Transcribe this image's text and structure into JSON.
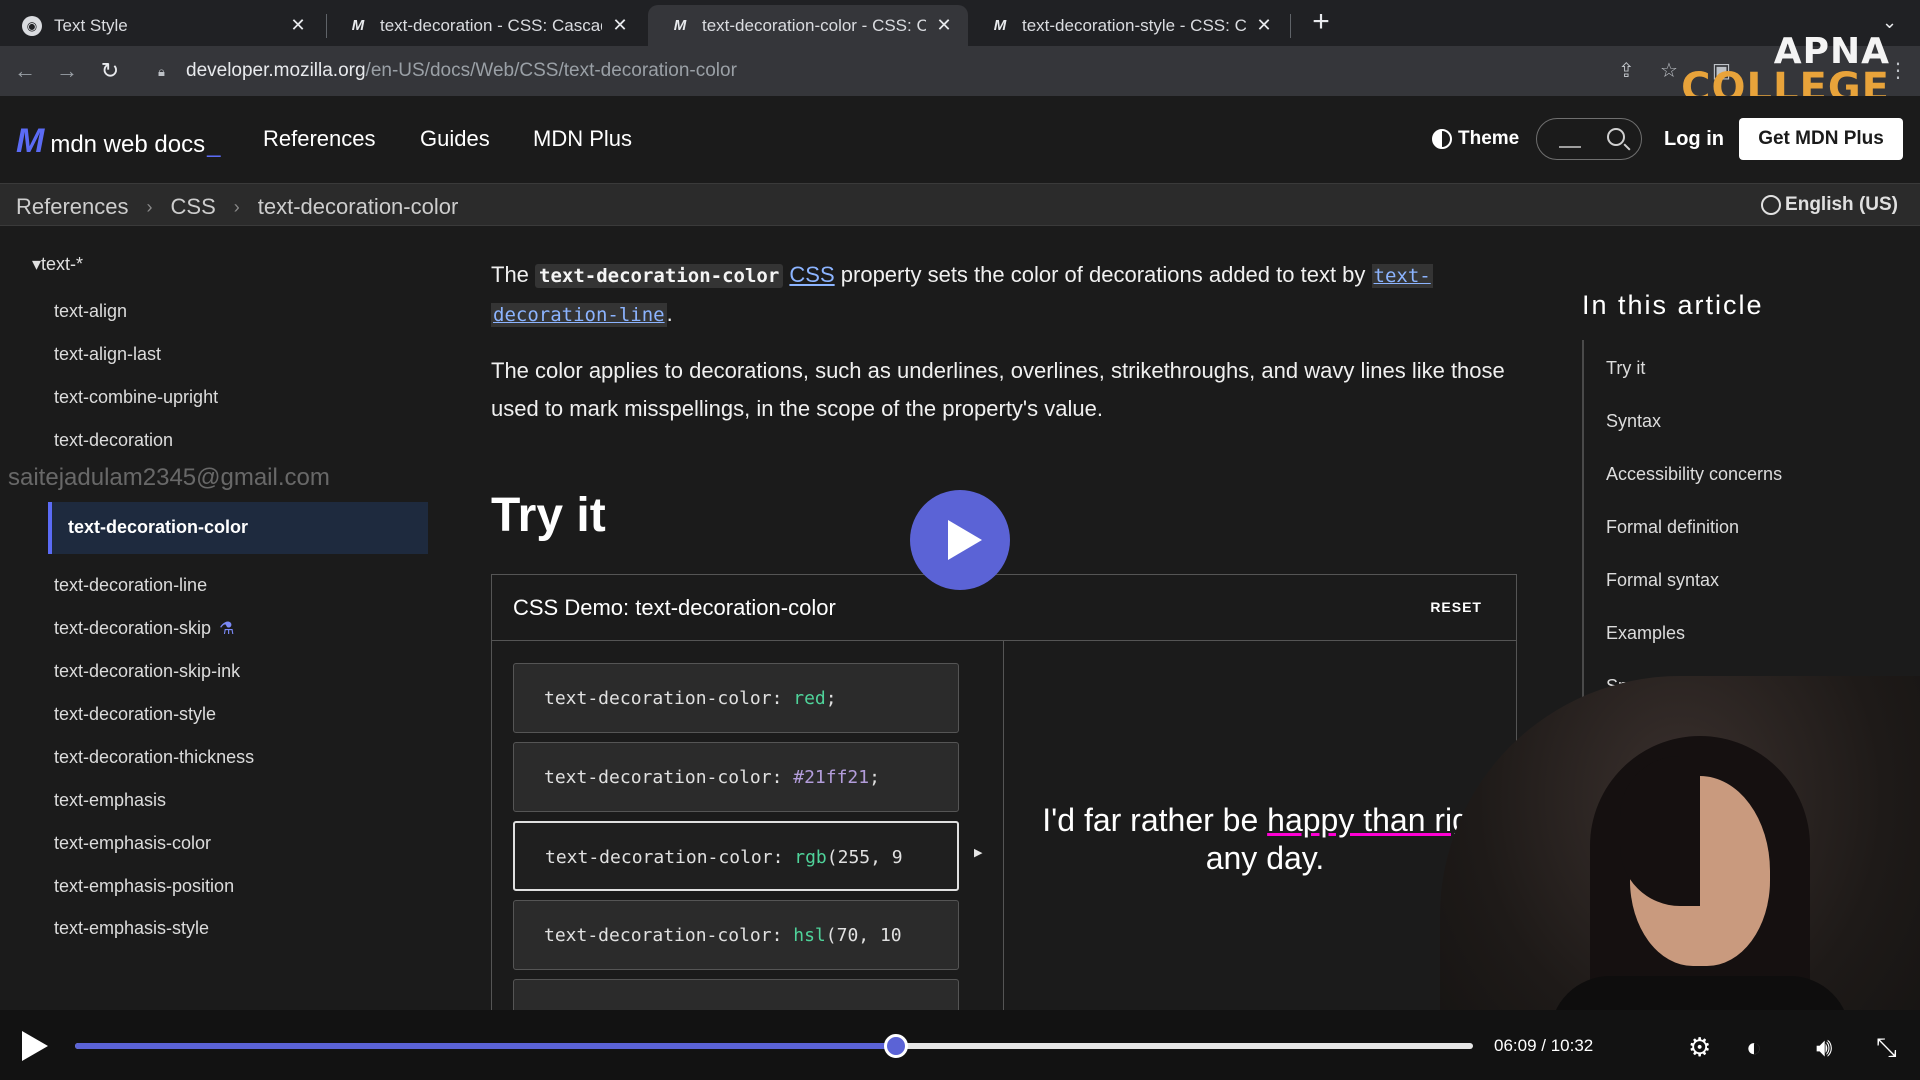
{
  "browser": {
    "tabs": [
      {
        "title": "Text Style",
        "icon": "globe-icon"
      },
      {
        "title": "text-decoration - CSS: Cascad",
        "icon": "mdn-icon"
      },
      {
        "title": "text-decoration-color - CSS: C",
        "icon": "mdn-icon",
        "active": true
      },
      {
        "title": "text-decoration-style - CSS: C",
        "icon": "mdn-icon"
      }
    ],
    "url_host": "developer.mozilla.org",
    "url_path": "/en-US/docs/Web/CSS/text-decoration-color"
  },
  "overlay_logo": {
    "line1": "APNA",
    "line2": "COLLEGE"
  },
  "mdn": {
    "logo_text": "mdn web docs",
    "nav": [
      "References",
      "Guides",
      "MDN Plus"
    ],
    "theme": "Theme",
    "login": "Log in",
    "get_plus": "Get MDN Plus",
    "breadcrumb": [
      "References",
      "CSS",
      "text-decoration-color"
    ],
    "language": "English (US)"
  },
  "sidebar": {
    "group": "▾text-*",
    "items": [
      "text-align",
      "text-align-last",
      "text-combine-upright",
      "text-decoration"
    ],
    "active": "text-decoration-color",
    "items_after": [
      "text-decoration-line",
      "text-decoration-skip",
      "text-decoration-skip-ink",
      "text-decoration-style",
      "text-decoration-thickness",
      "text-emphasis",
      "text-emphasis-color",
      "text-emphasis-position",
      "text-emphasis-style"
    ],
    "watermark": "saitejadulam2345@gmail.com"
  },
  "article": {
    "p1_the": "The",
    "p1_code": "text-decoration-color",
    "p1_link": "CSS",
    "p1_rest": "property sets the color of decorations added to text by",
    "p1_link2a": "text-",
    "p1_link2b": "decoration-line",
    "p1_end": ".",
    "p2": "The color applies to decorations, such as underlines, overlines, strikethroughs, and wavy lines like those used to mark misspellings, in the scope of the property's value.",
    "try_heading": "Try it"
  },
  "demo": {
    "title": "CSS Demo: text-decoration-color",
    "reset": "RESET",
    "choices": [
      {
        "prop": "text-decoration-color: ",
        "val": "red",
        "rest": ";"
      },
      {
        "prop": "text-decoration-color: ",
        "val": "#21ff21",
        "rest": ";"
      },
      {
        "prop": "text-decoration-color: ",
        "val": "rgb",
        "rest": "(255, 9"
      },
      {
        "prop": "text-decoration-color: ",
        "val": "hsl",
        "rest": "(70, 10"
      }
    ],
    "selected_index": 2,
    "output_pre": "I'd far rather be ",
    "output_underlined": "happy than righ",
    "output_line2": "any day.",
    "underline_color": "#ff00d4"
  },
  "toc": {
    "title": "In this article",
    "items": [
      "Try it",
      "Syntax",
      "Accessibility concerns",
      "Formal definition",
      "Formal syntax",
      "Examples",
      "Specifi"
    ]
  },
  "video": {
    "time": "06:09 / 10:32",
    "progress": 0.587
  },
  "colors": {
    "accent": "#5b63d6",
    "link": "#8cb4ff",
    "brand_orange": "#e8a33a"
  }
}
